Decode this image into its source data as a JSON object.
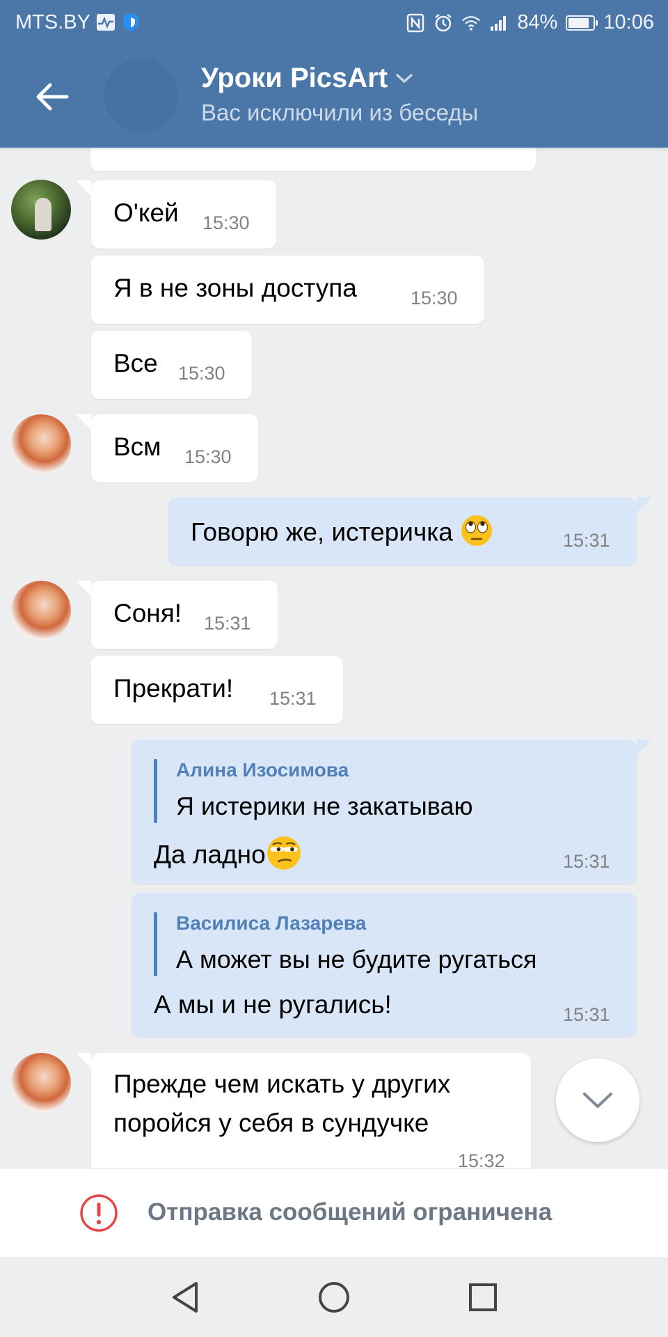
{
  "status_bar": {
    "carrier": "MTS.BY",
    "battery_percent": "84%",
    "battery_level": 0.84,
    "time": "10:06",
    "icons": [
      "pulse-icon",
      "shield-icon",
      "nfc-icon",
      "alarm-icon",
      "wifi-icon",
      "signal-icon",
      "battery-icon"
    ]
  },
  "header": {
    "title": "Уроки PicsArt",
    "subtitle": "Вас исключили из беседы",
    "back_icon": "arrow-left-icon",
    "title_chevron_icon": "chevron-down-icon"
  },
  "messages": [
    {
      "direction": "in",
      "text": "О'кей",
      "time": "15:30"
    },
    {
      "direction": "in",
      "text": "Я в не зоны доступа",
      "time": "15:30"
    },
    {
      "direction": "in",
      "text": "Все",
      "time": "15:30"
    },
    {
      "direction": "in",
      "text": "Всм",
      "time": "15:30"
    },
    {
      "direction": "out",
      "text": "Говорю же, истеричка",
      "emoji": "face-with-rolling-eyes-icon",
      "time": "15:31"
    },
    {
      "direction": "in",
      "text": "Соня!",
      "time": "15:31"
    },
    {
      "direction": "in",
      "text": "Прекрати!",
      "time": "15:31"
    },
    {
      "direction": "out",
      "reply": {
        "author": "Алина Изосимова",
        "text": "Я истерики не закатываю"
      },
      "text": "Да ладно",
      "emoji": "unamused-face-icon",
      "time": "15:31"
    },
    {
      "direction": "out",
      "reply": {
        "author": "Василиса Лазарева",
        "text": "А может вы не будите ругаться"
      },
      "text": "А мы и не ругались!",
      "time": "15:31"
    },
    {
      "direction": "in",
      "lines": [
        "Прежде чем искать у других",
        "поройся у себя в сундучке"
      ],
      "time": "15:32"
    }
  ],
  "scroll_down_icon": "chevron-down-icon",
  "restriction": {
    "icon": "warning-circle-icon",
    "text": "Отправка сообщений ограничена"
  },
  "nav_bar": {
    "icons": [
      "back-triangle-icon",
      "home-circle-icon",
      "recents-square-icon"
    ]
  },
  "colors": {
    "header": "#4a76a8",
    "background": "#edeef0",
    "incoming_bubble": "#ffffff",
    "outgoing_bubble": "#d8e6f8",
    "reply_accent": "#5181b8",
    "warning": "#e64646"
  }
}
